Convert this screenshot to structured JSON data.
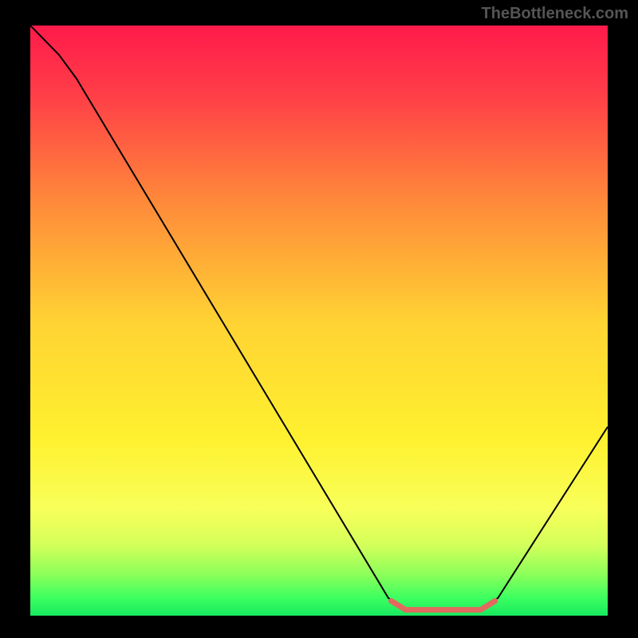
{
  "watermark": "TheBottleneck.com",
  "chart_data": {
    "type": "line",
    "title": "",
    "xlabel": "",
    "ylabel": "",
    "xlim": [
      0,
      100
    ],
    "ylim": [
      0,
      100
    ],
    "background": {
      "type": "vertical-gradient",
      "stops": [
        {
          "offset": 0.0,
          "color": "#ff1a4b"
        },
        {
          "offset": 0.12,
          "color": "#ff3f47"
        },
        {
          "offset": 0.3,
          "color": "#ff8a3a"
        },
        {
          "offset": 0.5,
          "color": "#ffd233"
        },
        {
          "offset": 0.7,
          "color": "#fff12f"
        },
        {
          "offset": 0.82,
          "color": "#f8ff5a"
        },
        {
          "offset": 0.88,
          "color": "#d4ff5a"
        },
        {
          "offset": 0.93,
          "color": "#8cff5a"
        },
        {
          "offset": 0.97,
          "color": "#3cff60"
        },
        {
          "offset": 1.0,
          "color": "#18e860"
        }
      ]
    },
    "series": [
      {
        "name": "bottleneck-curve",
        "color": "#000000",
        "width": 2,
        "points": [
          {
            "x": 0,
            "y": 100
          },
          {
            "x": 5,
            "y": 95
          },
          {
            "x": 8,
            "y": 91
          },
          {
            "x": 62,
            "y": 3
          },
          {
            "x": 65,
            "y": 1
          },
          {
            "x": 78,
            "y": 1
          },
          {
            "x": 81,
            "y": 3
          },
          {
            "x": 100,
            "y": 32
          }
        ]
      }
    ],
    "highlight": {
      "name": "optimal-range",
      "color": "#e2695f",
      "width": 7,
      "points": [
        {
          "x": 62.5,
          "y": 2.5
        },
        {
          "x": 65,
          "y": 1
        },
        {
          "x": 78,
          "y": 1
        },
        {
          "x": 80.5,
          "y": 2.5
        }
      ]
    }
  }
}
